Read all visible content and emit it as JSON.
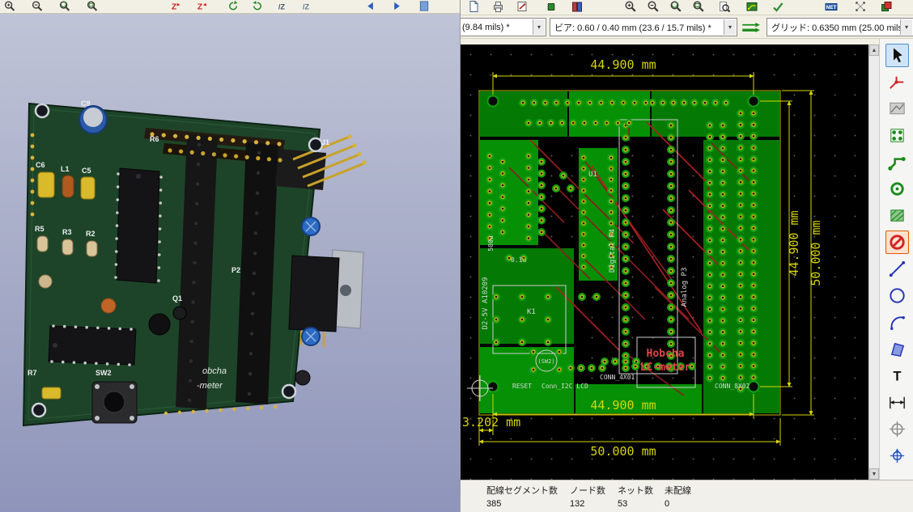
{
  "viewer3d": {
    "toolbar_icons": [
      "zoom-in",
      "zoom-out",
      "zoom-redraw",
      "zoom-fit",
      "rotate-z-pos",
      "rotate-z-neg",
      "orbit-cw",
      "orbit-ccw",
      "move-z-up",
      "move-z-down",
      "pan-left",
      "pan-right",
      "side-panel"
    ],
    "icon_glyphs": {
      "rotate_z": "Z",
      "slash_z": "/Z"
    },
    "board_labels": [
      "C9",
      "C6",
      "L1",
      "C5",
      "R6",
      "R5",
      "R3",
      "R2",
      "P2",
      "J1",
      "Q1",
      "SW2",
      "R7"
    ],
    "silk_text": [
      "obcha",
      "-meter"
    ]
  },
  "editor": {
    "toolbar_top_icons": [
      "new-board",
      "print",
      "plot",
      "footprint-editor",
      "footprint-browser",
      "zoom-in",
      "zoom-out",
      "zoom-redraw",
      "zoom-fit",
      "find",
      "3d-viewer",
      "drc-check",
      "net-inspector",
      "ratsnest",
      "layer-pair"
    ],
    "net_badge": "NET",
    "dropdowns": {
      "track_width": "(9.84 mils) *",
      "via": "ビア: 0.60 / 0.40 mm (23.6 / 15.7 mils) *",
      "grid": "グリッド: 0.6350 mm (25.00 mils)"
    },
    "dimensions": {
      "top": "44.900 mm",
      "bottom_inner": "44.900 mm",
      "bottom_outer": "50.000 mm",
      "right_inner": "44.900 mm",
      "right_outer": "50.000 mm",
      "offset": "3.202 mm"
    },
    "board_text": {
      "title1": "Hobcha",
      "title2": "LC-meter",
      "reset": "RESET",
      "conn_i2c": "Conn_I2C LCD",
      "conn_4x01": "CONN_4X01",
      "conn_8x02": "CONN_8X02",
      "sw2": "(SW2)",
      "k1": "K1",
      "cap1": "0.1u",
      "cap2": "500u",
      "left_rail": "D2-5V A10209",
      "digital": "Digital P4",
      "analog": "Analog P3",
      "u1": "U1"
    },
    "right_toolbar_icons": [
      "select",
      "highlight-net",
      "local-ratsnest",
      "add-footprint",
      "route-tracks",
      "add-via",
      "add-zone",
      "add-keepout",
      "add-graphic-line",
      "add-graphic-circle",
      "add-graphic-arc",
      "add-graphic-polygon",
      "add-text",
      "add-dimension",
      "add-target",
      "drill-origin"
    ],
    "tool_labels": {
      "text_tool": "T"
    },
    "status_fields": [
      {
        "label": "配線セグメント数",
        "value": "385"
      },
      {
        "label": "ノード数",
        "value": "132"
      },
      {
        "label": "ネット数",
        "value": "53"
      },
      {
        "label": "未配線",
        "value": "0"
      }
    ]
  }
}
